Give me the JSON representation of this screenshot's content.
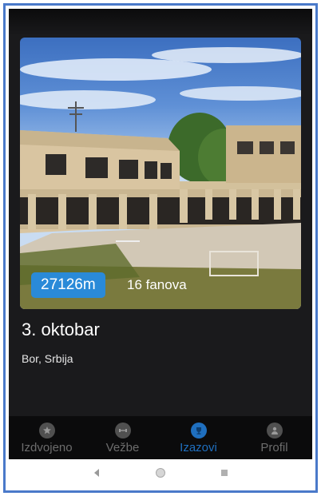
{
  "card": {
    "distance": "27126m",
    "fans": "16 fanova",
    "title": "3. oktobar",
    "location": "Bor, Srbija"
  },
  "bottom_nav": {
    "items": [
      {
        "label": "Izdvojeno",
        "icon": "star-icon",
        "active": false
      },
      {
        "label": "Vežbe",
        "icon": "dumbbell-icon",
        "active": false
      },
      {
        "label": "Izazovi",
        "icon": "trophy-icon",
        "active": true
      },
      {
        "label": "Profil",
        "icon": "person-icon",
        "active": false
      }
    ]
  },
  "system_nav": {
    "icons": [
      "back-icon",
      "home-icon",
      "recents-icon"
    ]
  },
  "colors": {
    "accent": "#2a8ad8",
    "active_nav": "#1f6fbf",
    "background": "#1a1a1c",
    "frame_border": "#4a79c9"
  }
}
